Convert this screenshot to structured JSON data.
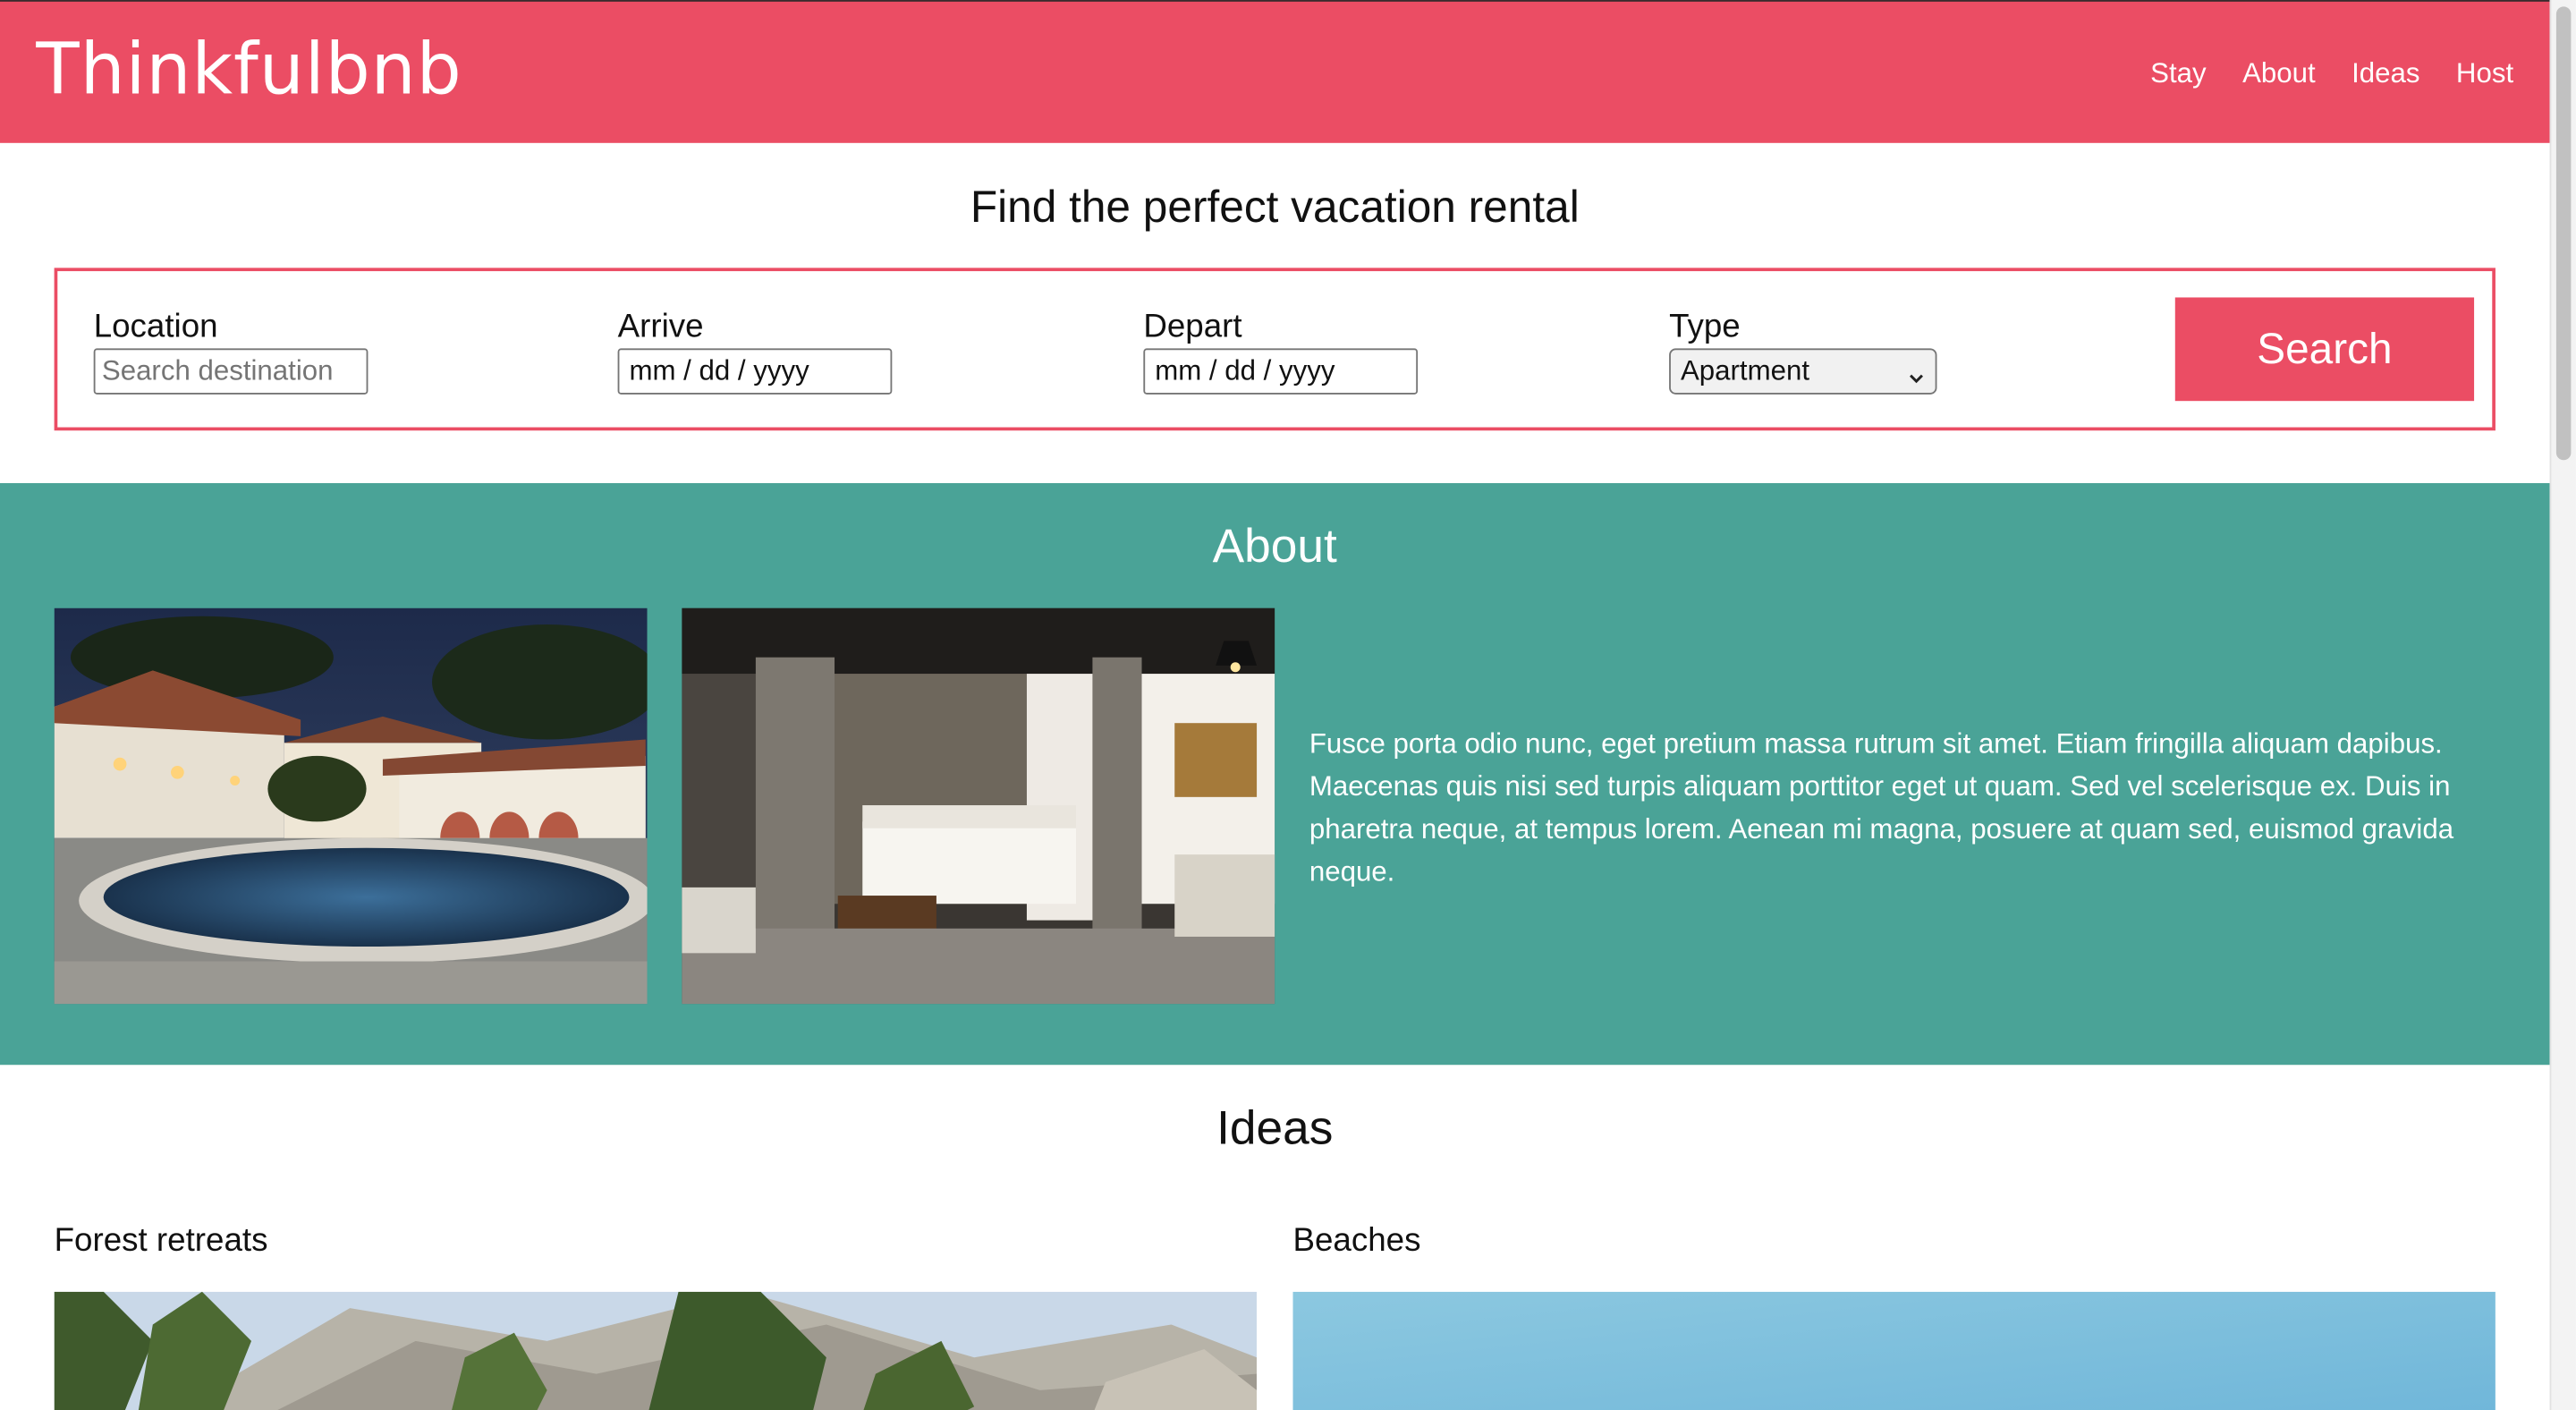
{
  "header": {
    "logo": "Thinkfulbnb",
    "nav": [
      "Stay",
      "About",
      "Ideas",
      "Host"
    ]
  },
  "search": {
    "title": "Find the perfect vacation rental",
    "location": {
      "label": "Location",
      "placeholder": "Search destination"
    },
    "arrive": {
      "label": "Arrive",
      "value": "mm / dd / yyyy"
    },
    "depart": {
      "label": "Depart",
      "value": "mm / dd / yyyy"
    },
    "type": {
      "label": "Type",
      "selected": "Apartment"
    },
    "button": "Search"
  },
  "about": {
    "title": "About",
    "text": "Fusce porta odio nunc, eget pretium massa rutrum sit amet. Etiam fringilla aliquam dapibus. Maecenas quis nisi sed turpis aliquam porttitor eget ut quam. Sed vel scelerisque ex. Duis in pharetra neque, at tempus lorem. Aenean mi magna, posuere at quam sed, euismod gravida neque."
  },
  "ideas": {
    "title": "Ideas",
    "items": [
      {
        "heading": "Forest retreats"
      },
      {
        "heading": "Beaches"
      }
    ]
  },
  "colors": {
    "brand": "#eb4d64",
    "about_bg": "#4aa397"
  },
  "icons": {
    "select_arrow": "chevron-down-icon"
  }
}
